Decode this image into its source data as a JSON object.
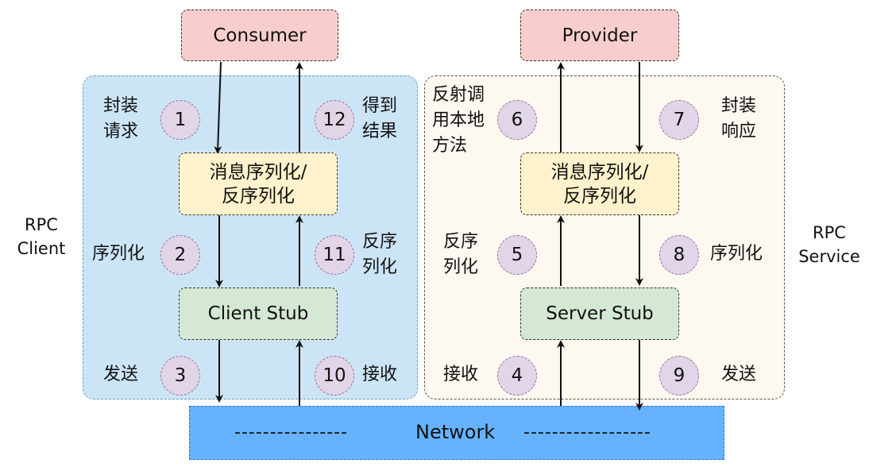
{
  "boxes": {
    "consumer": "Consumer",
    "provider": "Provider",
    "client_msg": "消息序列化/\n反序列化",
    "server_msg": "消息序列化/\n反序列化",
    "client_stub": "Client Stub",
    "server_stub": "Server Stub"
  },
  "sides": {
    "left": "RPC\nClient",
    "right": "RPC\nService"
  },
  "network": {
    "label": "Network",
    "dash_left": "----------------",
    "dash_right": "------------------"
  },
  "steps": [
    {
      "n": "1",
      "label": "封装\n请求"
    },
    {
      "n": "2",
      "label": "序列化"
    },
    {
      "n": "3",
      "label": "发送"
    },
    {
      "n": "4",
      "label": "接收"
    },
    {
      "n": "5",
      "label": "反序\n列化"
    },
    {
      "n": "6",
      "label": "反射调\n用本地\n方法"
    },
    {
      "n": "7",
      "label": "封装\n响应"
    },
    {
      "n": "8",
      "label": "序列化"
    },
    {
      "n": "9",
      "label": "发送"
    },
    {
      "n": "10",
      "label": "接收"
    },
    {
      "n": "11",
      "label": "反序\n列化"
    },
    {
      "n": "12",
      "label": "得到\n结果"
    }
  ],
  "colors": {
    "client_panel": "#cce5f6",
    "server_panel": "#fdf8f0",
    "network": "#66b2ff"
  }
}
